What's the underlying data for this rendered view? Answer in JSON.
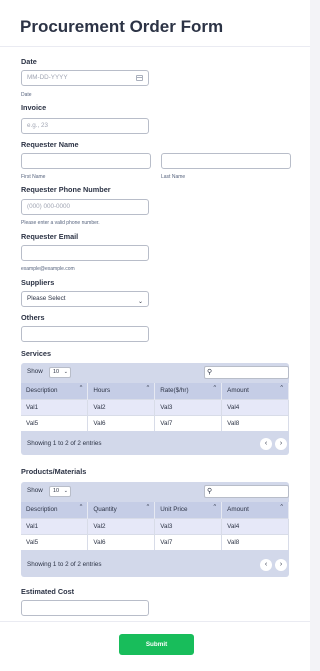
{
  "form": {
    "title": "Procurement Order Form"
  },
  "date": {
    "label": "Date",
    "placeholder": "MM-DD-YYYY",
    "sublabel": "Date"
  },
  "invoice": {
    "label": "Invoice",
    "placeholder": "e.g., 23"
  },
  "requester_name": {
    "label": "Requester Name",
    "first_sublabel": "First Name",
    "last_sublabel": "Last Name"
  },
  "requester_phone": {
    "label": "Requester Phone Number",
    "placeholder": "(000) 000-0000",
    "sublabel": "Please enter a valid phone number."
  },
  "requester_email": {
    "label": "Requester Email",
    "sublabel": "example@example.com"
  },
  "suppliers": {
    "label": "Suppliers",
    "selected": "Please Select"
  },
  "others": {
    "label": "Others"
  },
  "services": {
    "label": "Services",
    "show_label": "Show",
    "show_value": "10",
    "columns": [
      "Description",
      "Hours",
      "Rate($/hr)",
      "Amount"
    ],
    "rows": [
      [
        "Val1",
        "Val2",
        "Val3",
        "Val4"
      ],
      [
        "Val5",
        "Val6",
        "Val7",
        "Val8"
      ]
    ],
    "footer": "Showing 1 to 2 of 2 entries"
  },
  "products": {
    "label": "Products/Materials",
    "show_label": "Show",
    "show_value": "10",
    "columns": [
      "Description",
      "Quantity",
      "Unit Price",
      "Amount"
    ],
    "rows": [
      [
        "Val1",
        "Val2",
        "Val3",
        "Val4"
      ],
      [
        "Val5",
        "Val6",
        "Val7",
        "Val8"
      ]
    ],
    "footer": "Showing 1 to 2 of 2 entries"
  },
  "estimated_cost": {
    "label": "Estimated Cost"
  },
  "submit": {
    "label": "Submit"
  },
  "icons": {
    "search": "search-icon",
    "calendar": "calendar-icon",
    "chevron": "chevron-down-icon",
    "sort": "sort-icon",
    "prev": "chevron-left-icon",
    "next": "chevron-right-icon"
  }
}
